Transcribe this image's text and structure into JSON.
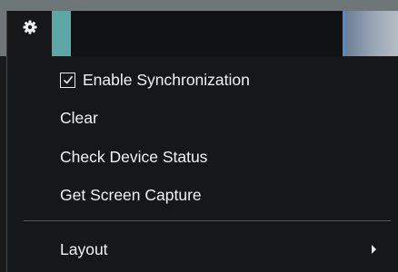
{
  "toolbar": {
    "settings_icon": "gear-icon"
  },
  "menu": {
    "enable_sync": {
      "label": "Enable Synchronization",
      "checked": true
    },
    "clear": {
      "label": "Clear"
    },
    "check_device_status": {
      "label": "Check Device Status"
    },
    "get_screen_capture": {
      "label": "Get Screen Capture"
    },
    "layout": {
      "label": "Layout",
      "has_submenu": true
    }
  },
  "colors": {
    "menu_bg": "#161718",
    "text": "#f2f2f2",
    "teal": "#5ea5a6",
    "accent_blue": "#4a8fd2"
  }
}
